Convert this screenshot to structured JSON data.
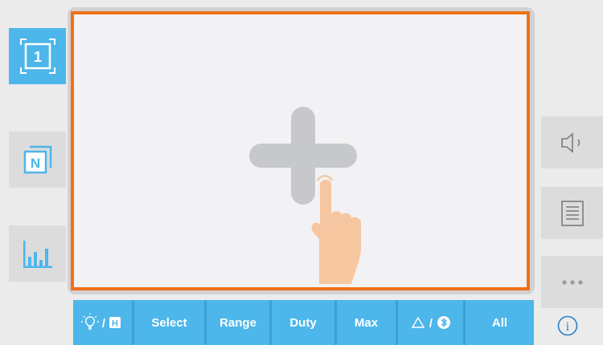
{
  "left_panel": {
    "single_mode": {
      "icon": "single-frame-icon",
      "number": "1"
    },
    "multi_mode": {
      "icon": "multi-frame-icon",
      "letter": "N"
    },
    "chart_mode": {
      "icon": "bar-chart-icon"
    }
  },
  "right_panel": {
    "sound": {
      "icon": "speaker-icon"
    },
    "list": {
      "icon": "list-icon"
    },
    "more": {
      "icon": "more-dots-icon"
    },
    "info": {
      "icon": "info-icon",
      "glyph": "i"
    }
  },
  "display": {
    "hint_icon": "tap-to-add-icon",
    "border_color": "#f07216"
  },
  "toolbar": {
    "light_hold": {
      "icon": "light-bulb-hold-icon",
      "separator": "/",
      "badge": "H"
    },
    "select_label": "Select",
    "range_label": "Range",
    "duty_label": "Duty",
    "max_label": "Max",
    "delta_bt": {
      "icon": "delta-bluetooth-icon",
      "separator": "/"
    },
    "all_label": "All"
  },
  "colors": {
    "accent": "#4db6ea",
    "background": "#ebebeb",
    "button_gray": "#dcdcdc",
    "highlight": "#f07216"
  }
}
